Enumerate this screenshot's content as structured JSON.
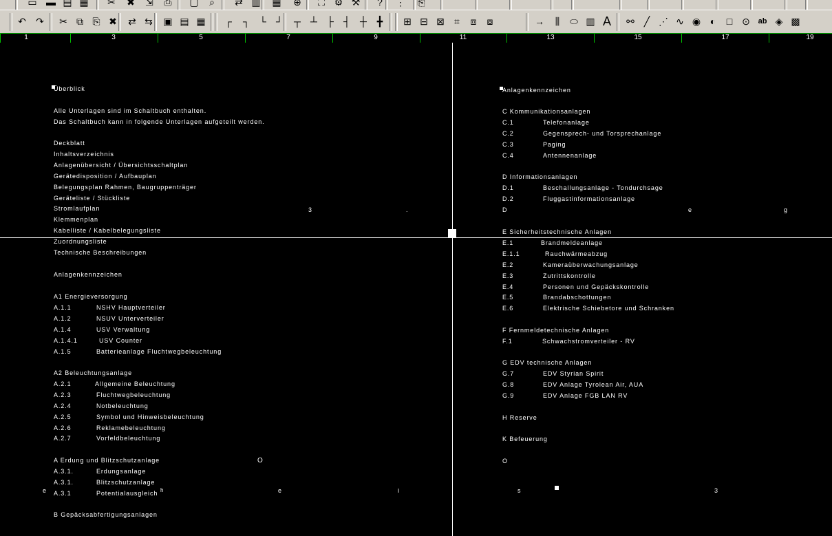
{
  "app": {
    "toolbar_top": [
      "paste-icon",
      "new-icon",
      "save-icon",
      "open-icon",
      "copy-icon",
      "cut-icon",
      "delete-icon",
      "export-icon",
      "print-icon",
      "preview-icon",
      "find-icon",
      "replace-icon",
      "layers-icon",
      "grid-icon",
      "zoom-icon",
      "binoculars-icon",
      "properties-icon",
      "settings-icon",
      "help-icon",
      "menu-icon"
    ],
    "toolbar_main": [
      {
        "name": "undo-icon",
        "glyph": "↶"
      },
      {
        "name": "redo-icon",
        "glyph": "↷"
      },
      {
        "name": "cut-icon",
        "glyph": "✂"
      },
      {
        "name": "copy-component-icon",
        "glyph": "⧉"
      },
      {
        "name": "paste-component-icon",
        "glyph": "⎘"
      },
      {
        "name": "delete-component-icon",
        "glyph": "✖"
      },
      {
        "name": "connect-icon",
        "glyph": "⇄"
      },
      {
        "name": "disconnect-icon",
        "glyph": "⇆"
      },
      {
        "name": "block-icon",
        "glyph": "▣"
      },
      {
        "name": "window-icon",
        "glyph": "▤"
      },
      {
        "name": "frame-icon",
        "glyph": "▦"
      },
      {
        "name": "corner-top-left-icon",
        "glyph": "┌"
      },
      {
        "name": "corner-top-right-icon",
        "glyph": "┐"
      },
      {
        "name": "corner-bottom-left-icon",
        "glyph": "└"
      },
      {
        "name": "corner-bottom-right-icon",
        "glyph": "┘"
      },
      {
        "name": "tee-down-icon",
        "glyph": "┬"
      },
      {
        "name": "tee-up-icon",
        "glyph": "┴"
      },
      {
        "name": "tee-right-icon",
        "glyph": "├"
      },
      {
        "name": "tee-left-icon",
        "glyph": "┤"
      },
      {
        "name": "cross-icon",
        "glyph": "┼"
      },
      {
        "name": "junction-icon",
        "glyph": "╋"
      },
      {
        "name": "terminal-icon",
        "glyph": "⊞"
      },
      {
        "name": "plug-icon",
        "glyph": "⊟"
      },
      {
        "name": "cable-icon",
        "glyph": "⊠"
      },
      {
        "name": "bracket-icon",
        "glyph": "⌗"
      },
      {
        "name": "device-box-icon",
        "glyph": "⧈"
      },
      {
        "name": "contact-icon",
        "glyph": "⧇"
      },
      {
        "name": "arrow-right-icon",
        "glyph": "→"
      },
      {
        "name": "multi-line-icon",
        "glyph": "⫼"
      },
      {
        "name": "oval-icon",
        "glyph": "⬭"
      },
      {
        "name": "table-icon",
        "glyph": "▥"
      },
      {
        "name": "text-icon",
        "glyph": "A"
      },
      {
        "name": "link-icon",
        "glyph": "⚯"
      },
      {
        "name": "line-tool-icon",
        "glyph": "╱"
      },
      {
        "name": "polyline-icon",
        "glyph": "⋰"
      },
      {
        "name": "waveform-icon",
        "glyph": "∿"
      },
      {
        "name": "circle-tool-icon",
        "glyph": "◉"
      },
      {
        "name": "arc-tool-icon",
        "glyph": "◐"
      },
      {
        "name": "rectangle-tool-icon",
        "glyph": "□"
      },
      {
        "name": "ellipse-tool-icon",
        "glyph": "⊙"
      },
      {
        "name": "text-style-icon",
        "glyph": "ab"
      },
      {
        "name": "fill-icon",
        "glyph": "◈"
      },
      {
        "name": "image-icon",
        "glyph": "▩"
      }
    ]
  },
  "ruler": {
    "numbers": [
      "1",
      "3",
      "5",
      "7",
      "9",
      "11",
      "13",
      "15",
      "17",
      "19"
    ]
  },
  "page_left": {
    "heading": "Überblick",
    "intro": [
      "Alle Unterlagen sind im Schaltbuch enthalten.",
      "Das Schaltbuch kann in folgende Unterlagen aufgeteilt werden."
    ],
    "documents": [
      "Deckblatt",
      "Inhaltsverzeichnis",
      "Anlagenübersicht / Übersichtsschaltplan",
      "Gerätedisposition / Aufbauplan",
      "Belegungsplan Rahmen, Baugruppenträger",
      "Geräteliste / Stückliste",
      "Stromlaufplan",
      "Klemmenplan",
      "Kabelliste / Kabelbelegungsliste",
      "Zuordnungsliste",
      "Technische Beschreibungen"
    ],
    "section_title": "Anlagenkennzeichen",
    "groups": [
      {
        "title": "A1  Energieversorgung",
        "items": [
          {
            "code": "A.1.1",
            "label": "NSHV Hauptverteiler"
          },
          {
            "code": "A.1.2",
            "label": "NSUV Unterverteiler"
          },
          {
            "code": "A.1.4",
            "label": "USV Verwaltung"
          },
          {
            "code": "A.1.4.1",
            "label": "USV Counter"
          },
          {
            "code": "A.1.5",
            "label": "Batterieanlage Fluchtwegbeleuchtung"
          }
        ]
      },
      {
        "title": "A2  Beleuchtungsanlage",
        "items": [
          {
            "code": "A.2.1",
            "label": "Allgemeine Beleuchtung"
          },
          {
            "code": "A.2.3",
            "label": "Fluchtwegbeleuchtung"
          },
          {
            "code": "A.2.4",
            "label": "Notbeleuchtung"
          },
          {
            "code": "A.2.5",
            "label": "Symbol und Hinweisbeleuchtung"
          },
          {
            "code": "A.2.6",
            "label": "Reklamebeleuchtung"
          },
          {
            "code": "A.2.7",
            "label": "Vorfeldbeleuchtung"
          }
        ]
      },
      {
        "title": "A   Erdung und Blitzschutzanlage",
        "items": [
          {
            "code": "A.3.1.",
            "label": "Erdungsanlage"
          },
          {
            "code": "A.3.1.",
            "label": "Blitzschutzanlage"
          },
          {
            "code": "A.3.1",
            "label": "Potentialausgleich"
          }
        ]
      },
      {
        "title": "B   Gepäcksabfertigungsanlagen",
        "items": []
      }
    ],
    "stray": {
      "s1": "3",
      "s2": ".",
      "s3": "O",
      "s4": "e",
      "s5": "h",
      "s6": "e",
      "s7": "i"
    }
  },
  "page_right": {
    "heading": "Anlagenkennzeichen",
    "groups": [
      {
        "title": "C  Kommunikationsanlagen",
        "items": [
          {
            "code": "C.1",
            "label": "Telefonanlage"
          },
          {
            "code": "C.2",
            "label": "Gegensprech- und Torsprechanlage"
          },
          {
            "code": "C.3",
            "label": "Paging"
          },
          {
            "code": "C.4",
            "label": "Antennenanlage"
          }
        ]
      },
      {
        "title": "D   Informationsanlagen",
        "items": [
          {
            "code": "D.1",
            "label": "Beschallungsanlage - Tondurchsage"
          },
          {
            "code": "D.2",
            "label": "Fluggastinformationsanlage"
          },
          {
            "code": "D",
            "label": ""
          }
        ]
      },
      {
        "title": "E   Sicherheitstechnische Anlagen",
        "items": [
          {
            "code": "E.1",
            "label": "Brandmeldeanlage"
          },
          {
            "code": "E.1.1",
            "label": "Rauchwärmeabzug"
          },
          {
            "code": "E.2",
            "label": "Kameraüberwachungsanlage"
          },
          {
            "code": "E.3",
            "label": "Zutrittskontrolle"
          },
          {
            "code": "E.4",
            "label": "Personen und Gepäckskontrolle"
          },
          {
            "code": "E.5",
            "label": "Brandabschottungen"
          },
          {
            "code": "E.6",
            "label": "Elektrische Schiebetore und Schranken"
          }
        ]
      },
      {
        "title": "F   Fernmeldetechnische Anlagen",
        "items": [
          {
            "code": "F.1",
            "label": "Schwachstromverteiler - RV"
          }
        ]
      },
      {
        "title": "G   EDV technische Anlagen",
        "items": [
          {
            "code": "G.7",
            "label": "EDV Styrian Spirit"
          },
          {
            "code": "G.8",
            "label": "EDV Anlage Tyrolean Air, AUA"
          },
          {
            "code": "G.9",
            "label": "EDV Anlage FGB LAN RV"
          }
        ]
      },
      {
        "title": "H   Reserve",
        "items": []
      },
      {
        "title": "K   Befeuerung",
        "items": []
      },
      {
        "title": "O",
        "items": []
      }
    ],
    "stray": {
      "s1": "e",
      "s2": "g",
      "s3": "s",
      "s4": "3"
    }
  }
}
